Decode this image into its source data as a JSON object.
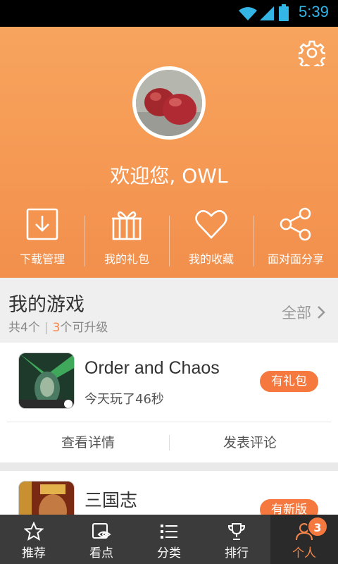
{
  "status_bar": {
    "time": "5:39"
  },
  "header": {
    "welcome": "欢迎您, OWL",
    "quick_actions": [
      {
        "label": "下载管理",
        "icon": "download-icon"
      },
      {
        "label": "我的礼包",
        "icon": "gift-icon"
      },
      {
        "label": "我的收藏",
        "icon": "heart-icon"
      },
      {
        "label": "面对面分享",
        "icon": "share-icon"
      }
    ]
  },
  "my_games": {
    "title": "我的游戏",
    "total_prefix": "共4个",
    "upgrade_count": "3",
    "upgrade_suffix": "个可升级",
    "all_label": "全部",
    "games": [
      {
        "name": "Order and Chaos",
        "meta": "今天玩了46秒",
        "badge": "有礼包",
        "details_label": "查看详情",
        "comment_label": "发表评论"
      },
      {
        "name": "三国志",
        "badge": "有新版"
      }
    ]
  },
  "nav": {
    "tabs": [
      {
        "label": "推荐",
        "icon": "star-icon"
      },
      {
        "label": "看点",
        "icon": "eye-icon"
      },
      {
        "label": "分类",
        "icon": "list-icon"
      },
      {
        "label": "排行",
        "icon": "trophy-icon"
      },
      {
        "label": "个人",
        "icon": "person-icon",
        "badge": "3"
      }
    ]
  },
  "colors": {
    "accent": "#f5864a",
    "header_top": "#f7a45e",
    "badge_bg": "#f5793f",
    "nav_bg": "#3b3b3b"
  }
}
